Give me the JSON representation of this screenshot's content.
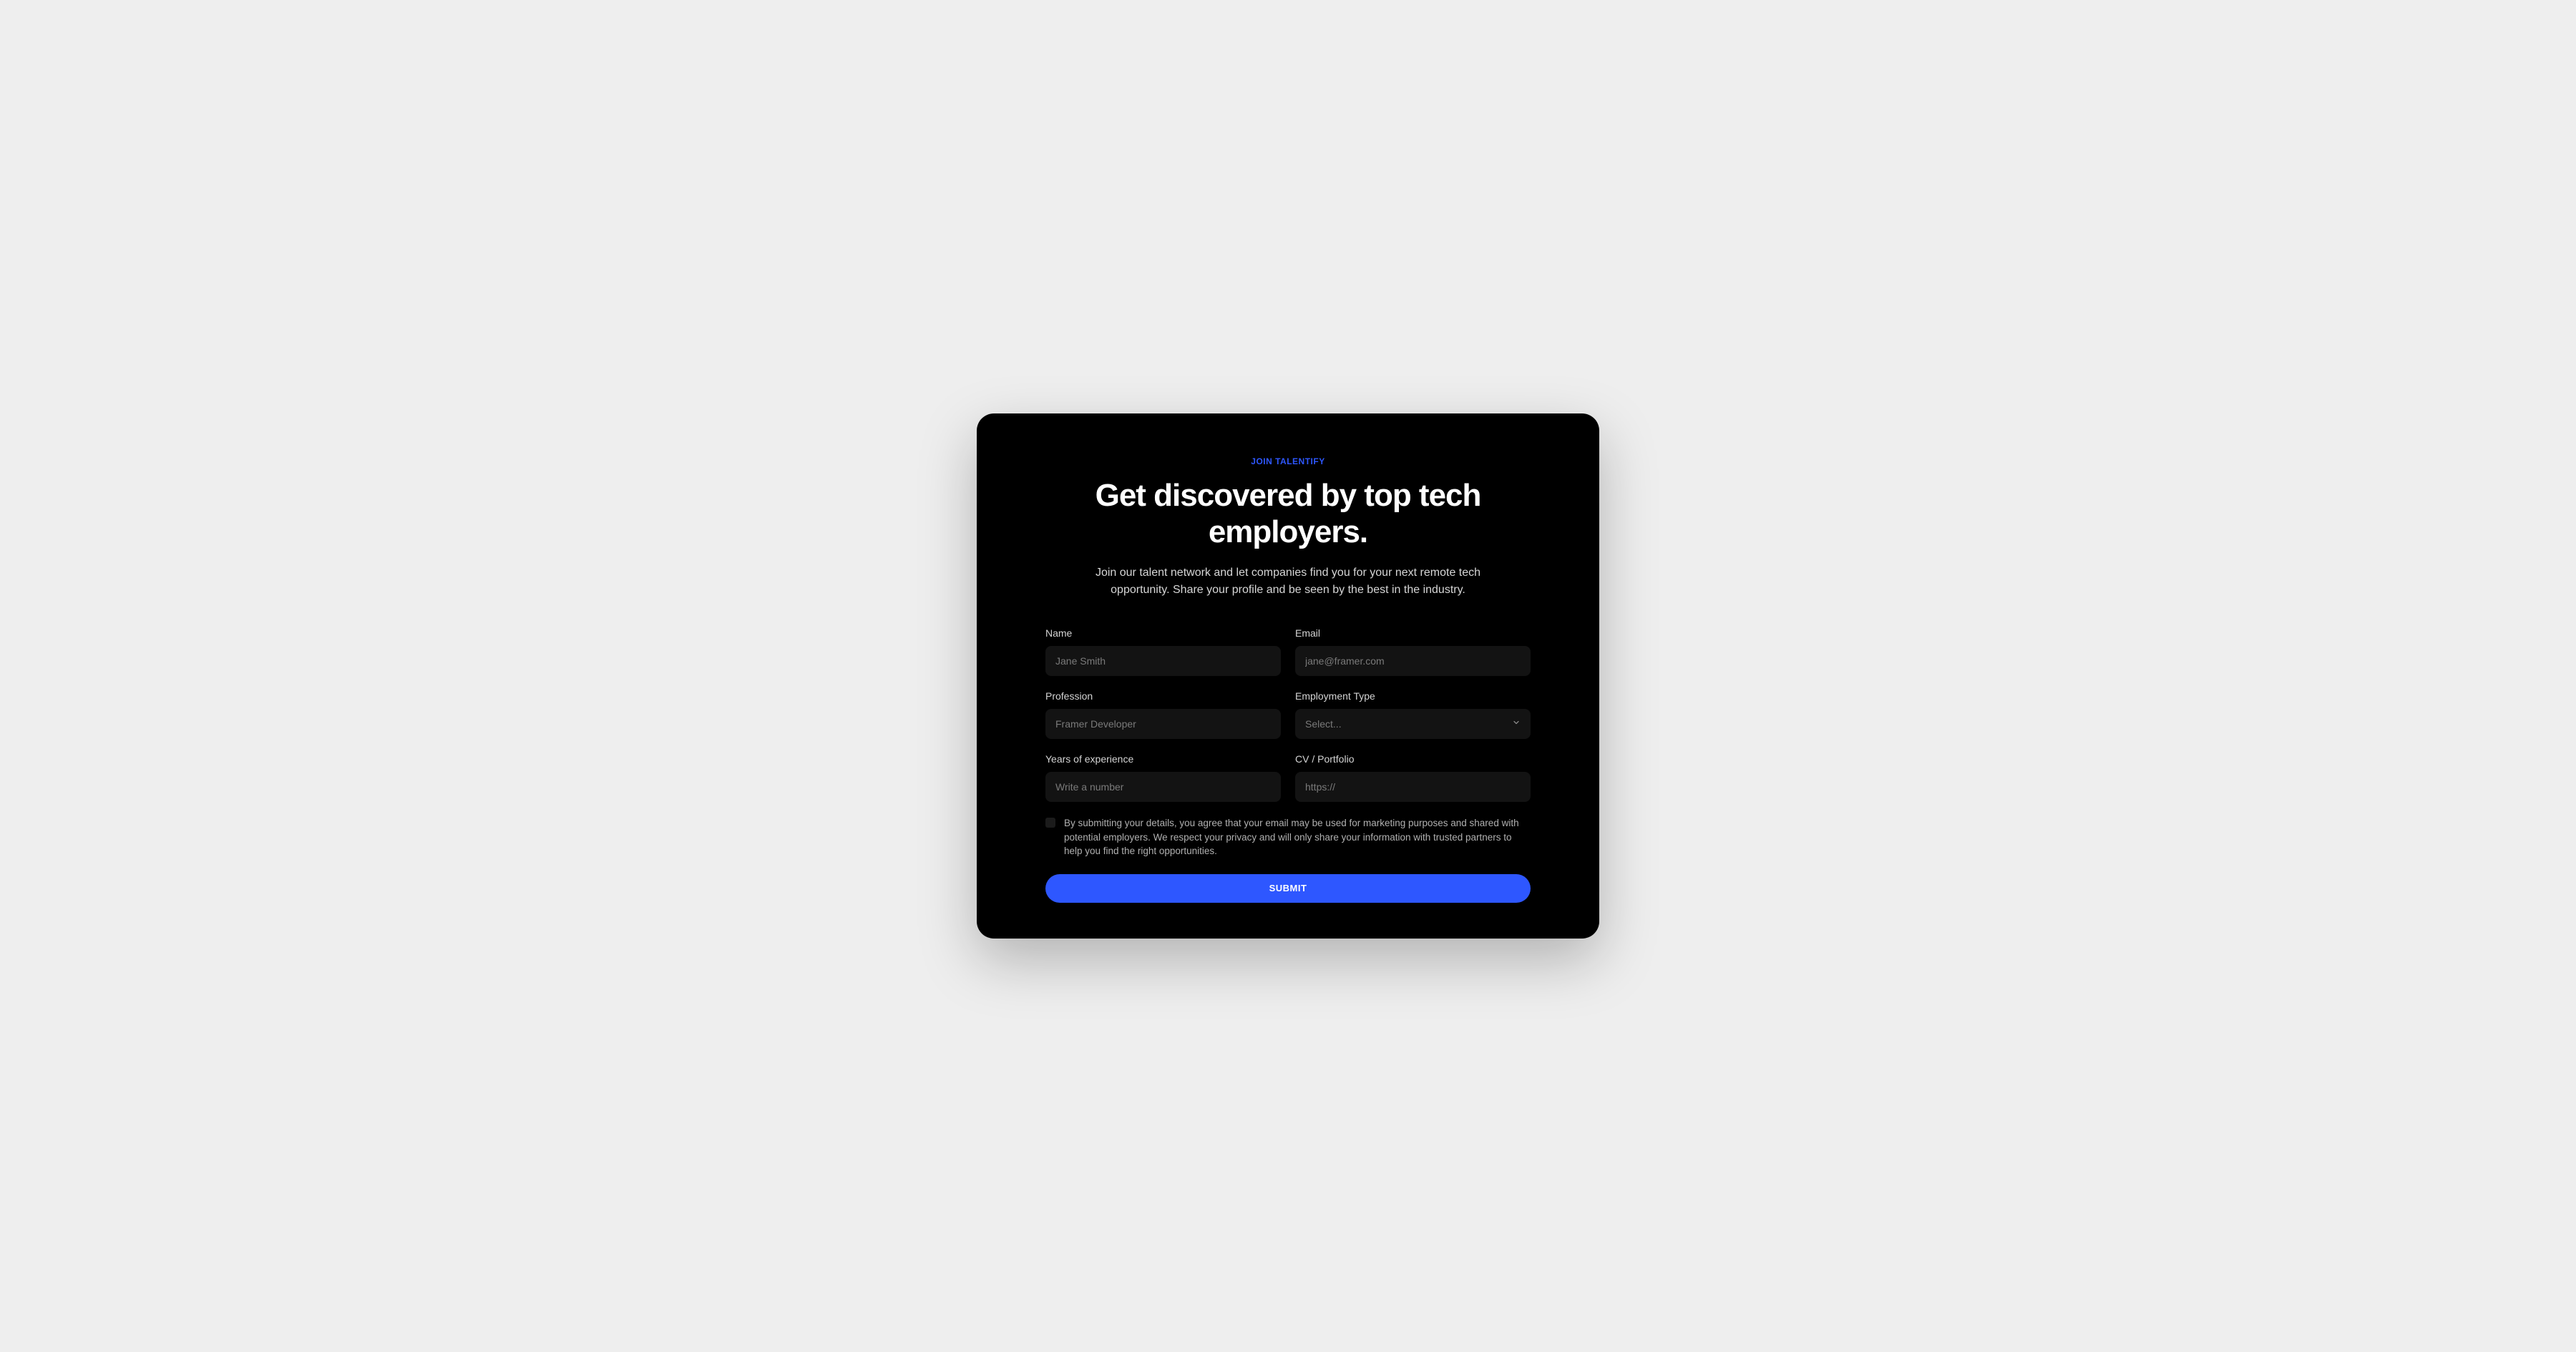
{
  "eyebrow": "JOIN TALENTIFY",
  "heading": "Get discovered by top tech employers.",
  "subheading": "Join our talent network and let companies find you for your next remote tech opportunity. Share your profile and be seen by the best in the industry.",
  "fields": {
    "name": {
      "label": "Name",
      "placeholder": "Jane Smith"
    },
    "email": {
      "label": "Email",
      "placeholder": "jane@framer.com"
    },
    "profession": {
      "label": "Profession",
      "placeholder": "Framer Developer"
    },
    "employment_type": {
      "label": "Employment Type",
      "placeholder": "Select..."
    },
    "experience": {
      "label": "Years of experience",
      "placeholder": "Write a number"
    },
    "cv": {
      "label": "CV / Portfolio",
      "placeholder": "https://"
    }
  },
  "consent_text": "By submitting your details, you agree that your email may be used for marketing purposes and shared with potential employers. We respect your privacy and will only share your information with trusted partners to help you find the right opportunities.",
  "submit_label": "SUBMIT",
  "colors": {
    "accent": "#2e57ff",
    "card_bg": "#000000",
    "page_bg": "#eeeeee",
    "input_bg": "#131313"
  }
}
